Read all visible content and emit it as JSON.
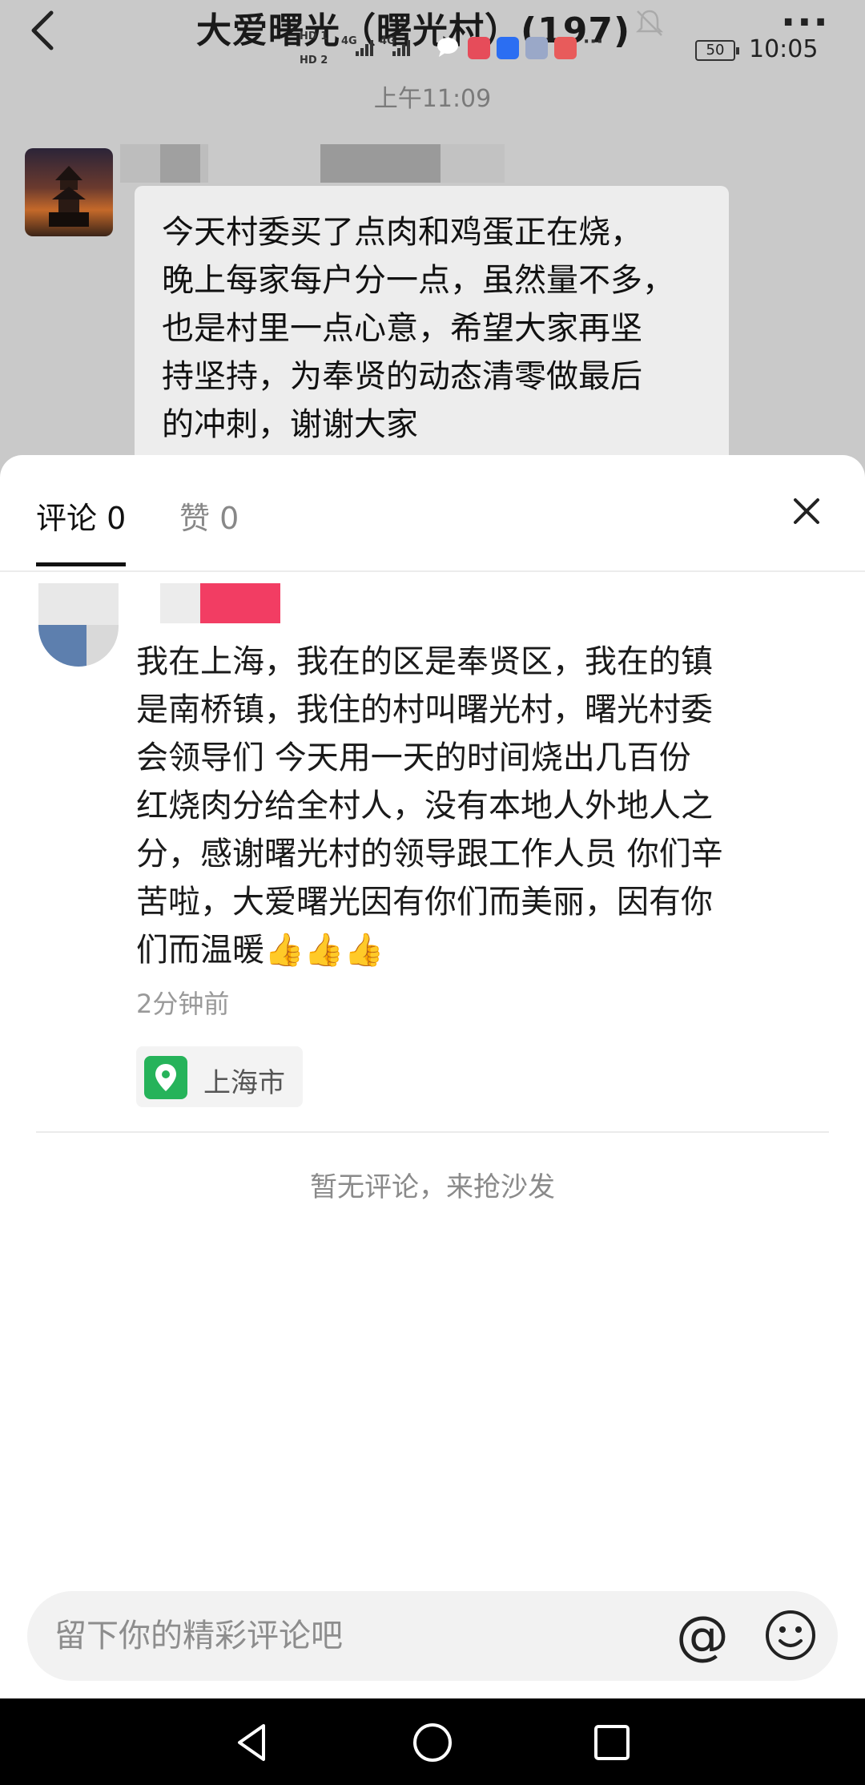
{
  "header": {
    "chat_title": "大爱曙光（曙光村）(197)",
    "more_label": "···"
  },
  "status_bar": {
    "sim1": "HD 1",
    "sim2": "HD 2",
    "net1": "4G",
    "net2": "4G",
    "battery": "50",
    "time": "10:05"
  },
  "message": {
    "time": "上午11:09",
    "text_lines": [
      "今天村委买了点肉和鸡蛋正在烧，",
      "晚上每家每户分一点，虽然量不多，",
      "也是村里一点心意，希望大家再坚",
      "持坚持，为奉贤的动态清零做最后",
      "的冲刺，谢谢大家"
    ]
  },
  "sheet": {
    "tab_comment": "评论 0",
    "tab_like": "赞 0",
    "post": {
      "text_lines": [
        "我在上海，我在的区是奉贤区，我在的镇",
        "是南桥镇，我住的村叫曙光村，曙光村委",
        "会领导们 今天用一天的时间烧出几百份",
        "红烧肉分给全村人，没有本地人外地人之",
        "分，感谢曙光村的领导跟工作人员 你们辛",
        "苦啦，大爱曙光因有你们而美丽，因有你",
        "们而温暖"
      ],
      "emoji": "👍👍👍",
      "time": "2分钟前",
      "location": "上海市"
    },
    "empty_note": "暂无评论，来抢沙发",
    "input_placeholder": "留下你的精彩评论吧",
    "at_symbol": "@"
  },
  "colors": {
    "location_green": "#26b35a",
    "blur_pink": "#f23d63"
  }
}
